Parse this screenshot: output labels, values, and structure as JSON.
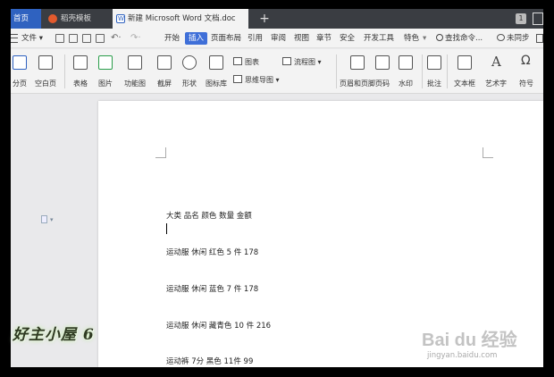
{
  "tabs": {
    "home": "首页",
    "templates": "稻壳模板",
    "document": "新建 Microsoft Word 文档.doc",
    "add": "+",
    "window_count": "1"
  },
  "menu": {
    "file": "文件",
    "items": [
      "开始",
      "插入",
      "页面布局",
      "引用",
      "审阅",
      "视图",
      "章节",
      "安全",
      "开发工具",
      "特色"
    ],
    "active": "插入",
    "search": "查找命令...",
    "sync": "未同步"
  },
  "ribbon": {
    "big_buttons": [
      {
        "name": "cover-page",
        "label": "分页"
      },
      {
        "name": "blank-page",
        "label": "空白页"
      },
      {
        "name": "table",
        "label": "表格"
      },
      {
        "name": "picture",
        "label": "图片"
      },
      {
        "name": "function-chart",
        "label": "功能图"
      },
      {
        "name": "screenshot",
        "label": "截屏"
      },
      {
        "name": "shape",
        "label": "形状"
      },
      {
        "name": "icon-library",
        "label": "图标库"
      },
      {
        "name": "header-footer",
        "label": "页眉和页脚"
      },
      {
        "name": "page-number",
        "label": "页码"
      },
      {
        "name": "watermark",
        "label": "水印"
      },
      {
        "name": "comment",
        "label": "批注"
      },
      {
        "name": "text-box",
        "label": "文本框"
      },
      {
        "name": "word-art",
        "label": "艺术字"
      },
      {
        "name": "symbol",
        "label": "符号"
      }
    ],
    "small_buttons": {
      "chart": "图表",
      "mind_map": "思维导图",
      "flowchart": "流程图"
    }
  },
  "document": {
    "lines": [
      "大类 品名 颜色 数量 金额",
      "运动服 休闲 红色 5 件 178",
      "运动服 休闲 蓝色 7 件 178",
      "运动服 休闲 藏青色 10 件 216",
      "运动裤 7分 黑色 11件 99"
    ]
  },
  "watermarks": {
    "left": "好主小屋 6",
    "baidu_logo": "Bai du 经验",
    "baidu_url": "jingyan.baidu.com"
  }
}
